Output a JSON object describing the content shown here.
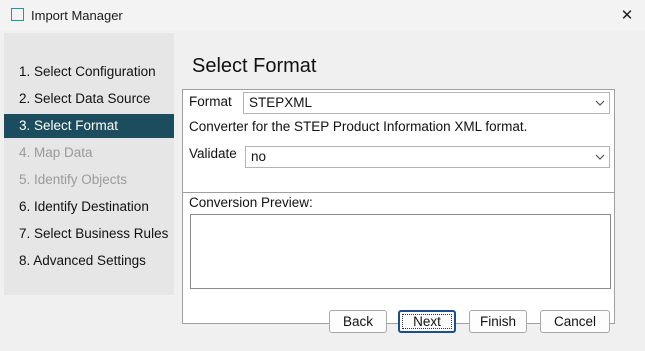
{
  "window": {
    "title": "Import Manager",
    "close_glyph": "✕",
    "icon": "window-app-icon"
  },
  "sidebar": {
    "steps": [
      {
        "label": "1. Select Configuration",
        "state": "normal"
      },
      {
        "label": "2. Select Data Source",
        "state": "normal"
      },
      {
        "label": "3. Select Format",
        "state": "active"
      },
      {
        "label": "4. Map Data",
        "state": "disabled"
      },
      {
        "label": "5. Identify Objects",
        "state": "disabled"
      },
      {
        "label": "6. Identify Destination",
        "state": "normal"
      },
      {
        "label": "7. Select Business Rules",
        "state": "normal"
      },
      {
        "label": "8. Advanced Settings",
        "state": "normal"
      }
    ],
    "active_color": "#1b4d5e"
  },
  "main": {
    "heading": "Select Format",
    "format_label": "Format",
    "format_value": "STEPXML",
    "description": "Converter for the STEP Product Information XML format.",
    "validate_label": "Validate",
    "validate_value": "no",
    "preview_label": "Conversion Preview:",
    "preview_text": ""
  },
  "buttons": {
    "back": "Back",
    "next": "Next",
    "finish": "Finish",
    "cancel": "Cancel",
    "default": "next"
  }
}
